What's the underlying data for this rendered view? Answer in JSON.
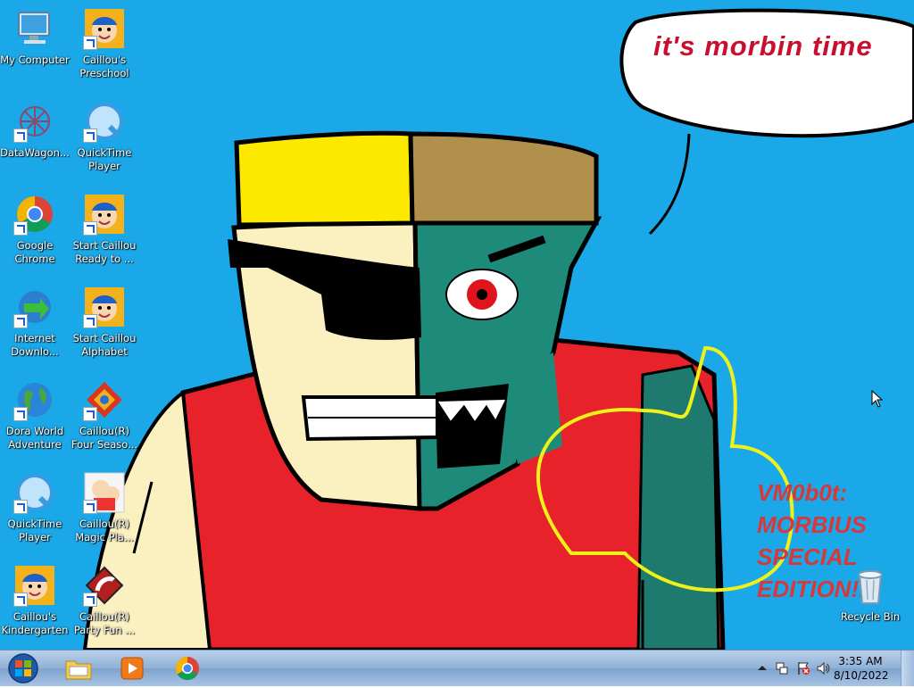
{
  "desktop": {
    "background_color": "#1aa8e8",
    "wallpaper": {
      "speech_bubble_text": "it's morbin time",
      "edition_lines": [
        "VM0b0t:",
        "MORBIUS",
        "SPECIAL",
        "EDITION!!"
      ]
    },
    "icons": [
      {
        "label": "My Computer",
        "icon": "computer-icon"
      },
      {
        "label": "Caillou's Preschool",
        "icon": "caillou-icon"
      },
      {
        "label": "DataWagon...",
        "icon": "datawagon-icon"
      },
      {
        "label": "QuickTime Player",
        "icon": "quicktime-icon"
      },
      {
        "label": "Google Chrome",
        "icon": "chrome-icon"
      },
      {
        "label": "Start Caillou Ready to ...",
        "icon": "caillou-icon"
      },
      {
        "label": "Internet Downlo...",
        "icon": "idm-icon"
      },
      {
        "label": "Start Caillou Alphabet",
        "icon": "caillou-icon"
      },
      {
        "label": "Dora World Adventure",
        "icon": "globe-icon"
      },
      {
        "label": "Caillou(R) Four Seaso...",
        "icon": "caillou-seasons-icon"
      },
      {
        "label": "QuickTime Player",
        "icon": "quicktime-icon"
      },
      {
        "label": "Caillou(R) Magic Pla...",
        "icon": "caillou-magic-icon"
      },
      {
        "label": "Caillou's Kindergarten",
        "icon": "caillou-icon"
      },
      {
        "label": "Caillou(R) Party Fun ...",
        "icon": "caillou-party-icon"
      },
      {
        "label": "Recycle Bin",
        "icon": "recycle-bin-icon"
      }
    ]
  },
  "taskbar": {
    "start_button": "start-orb-icon",
    "pinned": [
      "explorer-folder-icon",
      "media-player-icon",
      "chrome-icon"
    ],
    "tray_icons": [
      "show-hidden-icons-arrow",
      "network-icon",
      "action-center-icon",
      "volume-icon"
    ],
    "clock": {
      "time": "3:35 AM",
      "date": "8/10/2022"
    }
  }
}
